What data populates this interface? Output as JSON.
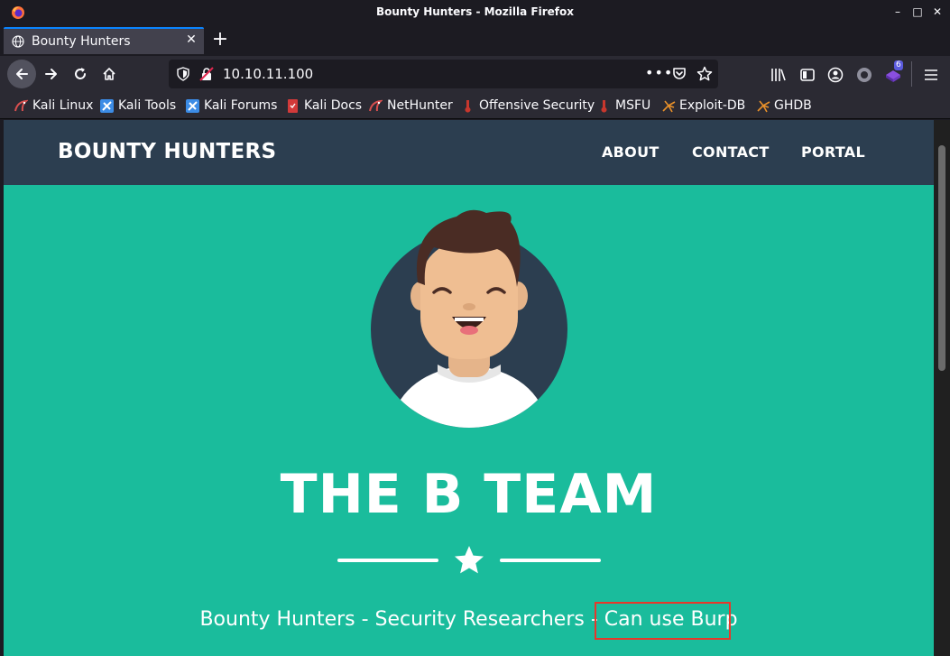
{
  "window": {
    "title": "Bounty Hunters - Mozilla Firefox"
  },
  "tab": {
    "label": "Bounty Hunters"
  },
  "urlbar": {
    "url": "10.10.11.100",
    "more_label": "•••"
  },
  "toolbar": {
    "extension_badge": "6"
  },
  "bookmarks": [
    {
      "label": "Kali Linux",
      "icon": "kali-dragon-icon",
      "color": "#d94f4f"
    },
    {
      "label": "Kali Tools",
      "icon": "kali-tools-icon",
      "color": "#3c8ce6"
    },
    {
      "label": "Kali Forums",
      "icon": "kali-forums-icon",
      "color": "#3c8ce6"
    },
    {
      "label": "Kali Docs",
      "icon": "kali-docs-icon",
      "color": "#d23a3a"
    },
    {
      "label": "NetHunter",
      "icon": "nethunter-icon",
      "color": "#d94f4f"
    },
    {
      "label": "Offensive Security",
      "icon": "offsec-icon",
      "color": "#c8372d"
    },
    {
      "label": "MSFU",
      "icon": "msfu-icon",
      "color": "#c8372d"
    },
    {
      "label": "Exploit-DB",
      "icon": "exploit-db-icon",
      "color": "#e8902a"
    },
    {
      "label": "GHDB",
      "icon": "ghdb-icon",
      "color": "#e8902a"
    }
  ],
  "site": {
    "brand": "BOUNTY HUNTERS",
    "nav": [
      "ABOUT",
      "CONTACT",
      "PORTAL"
    ],
    "hero_title": "THE B TEAM",
    "subtitle_prefix": "Bounty Hunters - Security Researchers - ",
    "subtitle_highlight": "Can use Burp"
  },
  "colors": {
    "page_bg": "#1abc9c",
    "nav_bg": "#2c3e50",
    "highlight_border": "#e8372a"
  }
}
